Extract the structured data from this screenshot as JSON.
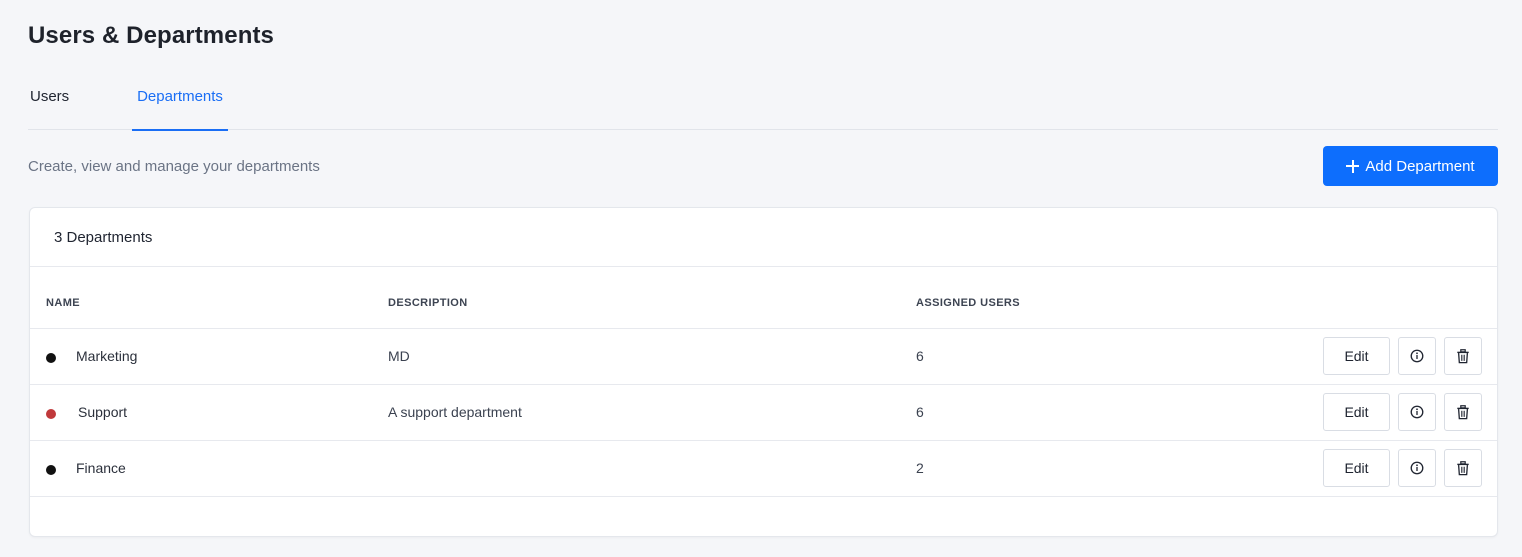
{
  "page": {
    "title": "Users & Departments",
    "subtitle": "Create, view and manage your departments"
  },
  "tabs": [
    {
      "label": "Users",
      "active": false
    },
    {
      "label": "Departments",
      "active": true
    }
  ],
  "actions": {
    "add_department_label": "Add Department"
  },
  "card": {
    "count_label": "3 Departments"
  },
  "table": {
    "columns": [
      "NAME",
      "DESCRIPTION",
      "ASSIGNED USERS"
    ],
    "rows": [
      {
        "name": "Marketing",
        "description": "MD",
        "assigned_users": "6",
        "color": "#111111"
      },
      {
        "name": "Support",
        "description": "A support department",
        "assigned_users": "6",
        "color": "#c0393b"
      },
      {
        "name": "Finance",
        "description": "",
        "assigned_users": "2",
        "color": "#111111"
      }
    ],
    "edit_label": "Edit"
  },
  "icons": {
    "add": "plus-icon",
    "info": "info-icon",
    "delete": "trash-icon"
  },
  "colors": {
    "accent": "#0d6efd",
    "active_tab": "#1a6ef5"
  }
}
